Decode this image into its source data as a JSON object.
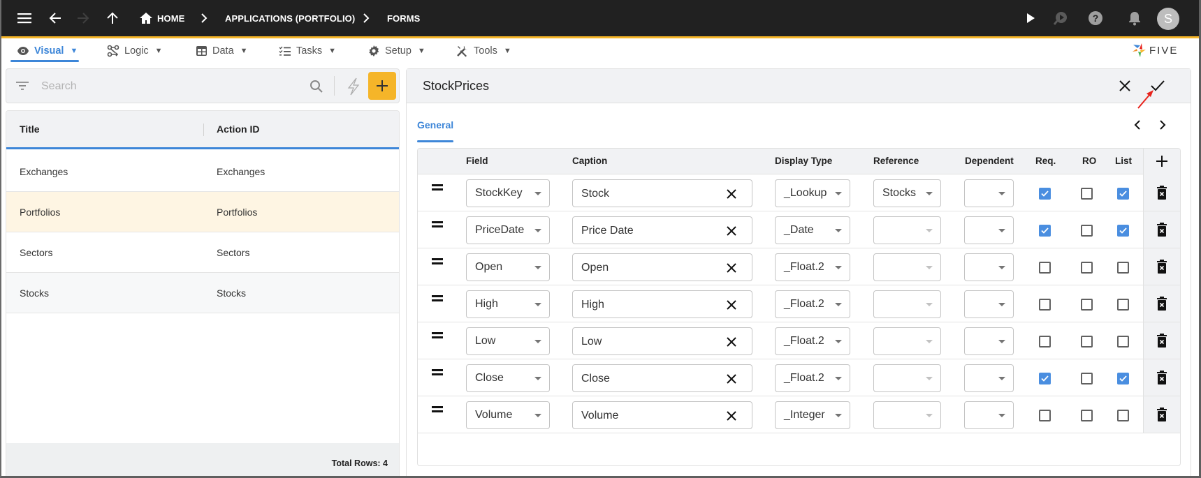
{
  "topbar": {
    "breadcrumbs": [
      {
        "label": "HOME",
        "icon": "home-icon"
      },
      {
        "label": "APPLICATIONS (PORTFOLIO)"
      },
      {
        "label": "FORMS"
      }
    ],
    "icons": [
      "menu-icon",
      "back-arrow-icon",
      "forward-arrow-icon",
      "up-arrow-icon",
      "play-icon",
      "run-search-icon",
      "help-icon",
      "bell-icon"
    ],
    "avatar_initial": "S"
  },
  "menubar": {
    "items": [
      {
        "label": "Visual",
        "caret": "▼",
        "icon": "eye-icon",
        "active": true
      },
      {
        "label": "Logic",
        "caret": "▼",
        "icon": "logic-flow-icon"
      },
      {
        "label": "Data",
        "caret": "▼",
        "icon": "table-grid-icon"
      },
      {
        "label": "Tasks",
        "caret": "▼",
        "icon": "checklist-icon"
      },
      {
        "label": "Setup",
        "caret": "▼",
        "icon": "gear-icon"
      },
      {
        "label": "Tools",
        "caret": "▼",
        "icon": "tools-icon"
      }
    ],
    "logo_text": "FIVE"
  },
  "list": {
    "search_placeholder": "Search",
    "columns": [
      "Title",
      "Action ID"
    ],
    "rows": [
      {
        "title": "Exchanges",
        "action_id": "Exchanges"
      },
      {
        "title": "Portfolios",
        "action_id": "Portfolios",
        "selected": true
      },
      {
        "title": "Sectors",
        "action_id": "Sectors"
      },
      {
        "title": "Stocks",
        "action_id": "Stocks"
      }
    ],
    "total_rows": "Total Rows: 4"
  },
  "form": {
    "title": "StockPrices",
    "tabs": [
      {
        "label": "General",
        "active": true
      }
    ],
    "grid": {
      "columns": [
        "Field",
        "Caption",
        "Display Type",
        "Reference",
        "Dependent",
        "Req.",
        "RO",
        "List"
      ],
      "rows": [
        {
          "field": "StockKey",
          "caption": "Stock",
          "display_type": "_Lookup",
          "reference": "Stocks",
          "dependent": "",
          "req": true,
          "ro": false,
          "list": true
        },
        {
          "field": "PriceDate",
          "caption": "Price Date",
          "display_type": "_Date",
          "reference": "",
          "dependent": "",
          "req": true,
          "ro": false,
          "list": true
        },
        {
          "field": "Open",
          "caption": "Open",
          "display_type": "_Float.2",
          "reference": "",
          "dependent": "",
          "req": false,
          "ro": false,
          "list": false
        },
        {
          "field": "High",
          "caption": "High",
          "display_type": "_Float.2",
          "reference": "",
          "dependent": "",
          "req": false,
          "ro": false,
          "list": false
        },
        {
          "field": "Low",
          "caption": "Low",
          "display_type": "_Float.2",
          "reference": "",
          "dependent": "",
          "req": false,
          "ro": false,
          "list": false
        },
        {
          "field": "Close",
          "caption": "Close",
          "display_type": "_Float.2",
          "reference": "",
          "dependent": "",
          "req": true,
          "ro": false,
          "list": true
        },
        {
          "field": "Volume",
          "caption": "Volume",
          "display_type": "_Integer",
          "reference": "",
          "dependent": "",
          "req": false,
          "ro": false,
          "list": false
        }
      ]
    }
  },
  "colors": {
    "topbar_bg": "#212121",
    "accent_yellow": "#f5b529",
    "accent_blue": "#3d86d8",
    "checkbox_on": "#4a8ee0",
    "selected_row": "#fef5e3",
    "annotation_arrow": "#e8231c"
  }
}
